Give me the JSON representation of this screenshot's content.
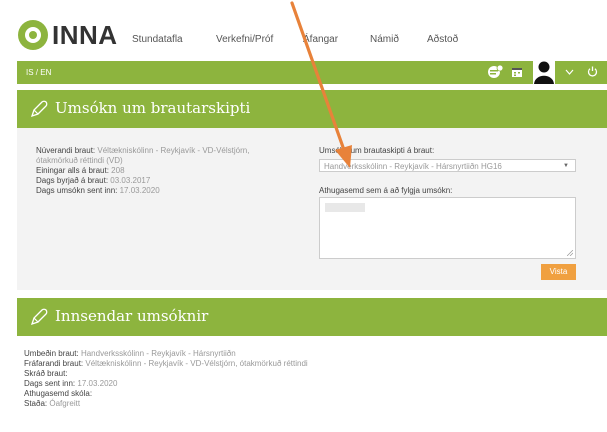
{
  "app": {
    "logo_text": "INNA"
  },
  "nav": [
    "Stundatafla",
    "Verkefni/Próf",
    "Áfangar",
    "Námið",
    "Aðstoð"
  ],
  "language": "IS / EN",
  "section1": {
    "title": "Umsókn um brautarskipti",
    "current_label": "Núverandi braut:",
    "current_value": "Véltækniskólinn - Reykjavík - VD-Vélstjórn, ótakmörkuð réttindi (VD)",
    "units_label": "Einingar alls á braut:",
    "units_value": "208",
    "start_label": "Dags byrjað á braut:",
    "start_value": "03.03.2017",
    "sent_label": "Dags umsókn sent inn:",
    "sent_value": "17.03.2020",
    "apply_label": "Umsókn um brautaskipti á braut:",
    "apply_selected": "Handverksskólinn - Reykjavík - Hársnyrtiiðn HG16",
    "comment_label": "Athugasemd sem á að fylgja umsókn:",
    "save_button": "Vista"
  },
  "section2": {
    "title": "Innsendar umsóknir",
    "rows": [
      {
        "label": "Umbeðin braut:",
        "value": "Handverksskólinn - Reykjavík - Hársnyrtiiðn"
      },
      {
        "label": "Fráfarandi braut:",
        "value": "Véltækniskólinn - Reykjavík - VD-Vélstjórn, ótakmörkuð réttindi"
      },
      {
        "label": "Skráð braut:",
        "value": ""
      },
      {
        "label": "Dags sent inn:",
        "value": "17.03.2020"
      },
      {
        "label": "Athugasemd skóla:",
        "value": ""
      },
      {
        "label": "Staða:",
        "value": "Óafgreitt"
      }
    ]
  },
  "colors": {
    "brand_green": "#8db43e",
    "button_orange": "#f0a040",
    "arrow": "#e8823a"
  }
}
